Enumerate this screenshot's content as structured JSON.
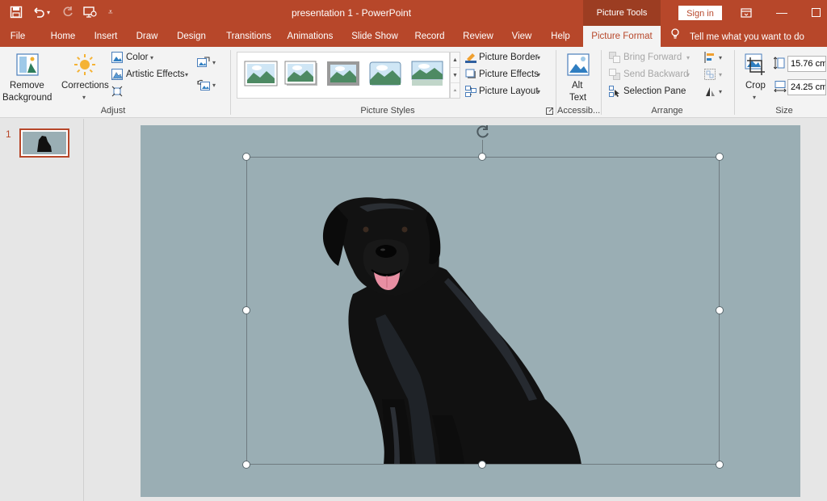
{
  "titlebar": {
    "title": "presentation 1  -  PowerPoint",
    "context_tab": "Picture Tools",
    "sign_in": "Sign in"
  },
  "tabs": [
    "File",
    "Home",
    "Insert",
    "Draw",
    "Design",
    "Transitions",
    "Animations",
    "Slide Show",
    "Record",
    "Review",
    "View",
    "Help",
    "Picture Format"
  ],
  "active_tab": "Picture Format",
  "tell_me": "Tell me what you want to do",
  "ribbon": {
    "adjust": {
      "remove_background": [
        "Remove",
        "Background"
      ],
      "corrections": "Corrections",
      "color": "Color",
      "artistic_effects": "Artistic Effects",
      "label": "Adjust"
    },
    "picture_styles": {
      "picture_border": "Picture Border",
      "picture_effects": "Picture Effects",
      "picture_layout": "Picture Layout",
      "label": "Picture Styles"
    },
    "accessibility": {
      "alt_text": [
        "Alt",
        "Text"
      ],
      "label": "Accessib..."
    },
    "arrange": {
      "bring_forward": "Bring Forward",
      "send_backward": "Send Backward",
      "selection_pane": "Selection Pane",
      "label": "Arrange"
    },
    "size": {
      "crop": "Crop",
      "height": "15.76 cm",
      "width": "24.25 cm",
      "label": "Size"
    }
  },
  "thumbnails": {
    "slide_number": "1"
  },
  "colors": {
    "accent": "#b7472a",
    "slide_background": "#9aaeb4"
  }
}
